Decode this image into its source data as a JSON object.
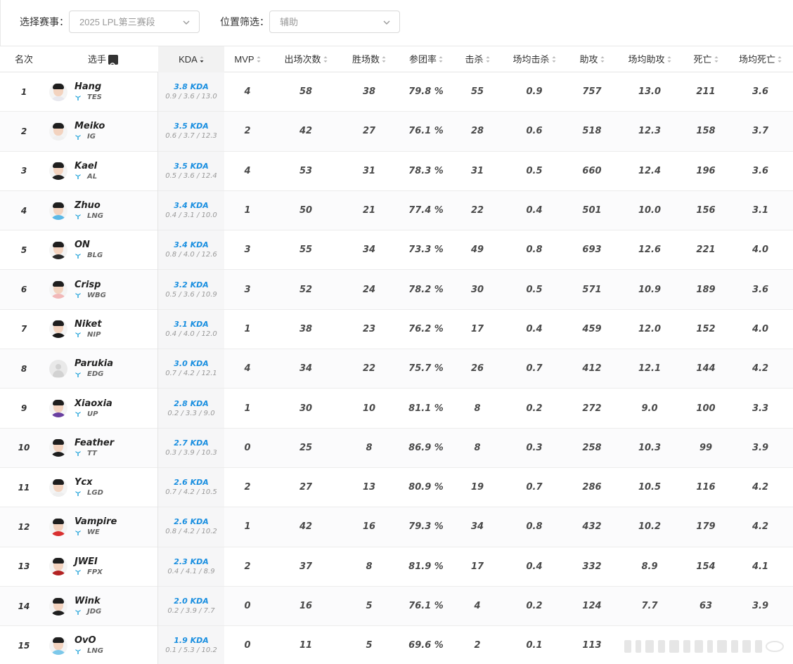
{
  "filters": {
    "event_label": "选择赛事：",
    "event_value": "2025 LPL第三赛段",
    "position_label": "位置筛选：",
    "position_value": "辅助"
  },
  "columns": {
    "rank": "名次",
    "player": "选手",
    "kda": "KDA",
    "mvp": "MVP",
    "games": "出场次数",
    "wins": "胜场数",
    "kp": "参团率",
    "kills": "击杀",
    "avg_kills": "场均击杀",
    "assists": "助攻",
    "avg_assists": "场均助攻",
    "deaths": "死亡",
    "avg_deaths": "场均死亡"
  },
  "rows": [
    {
      "rank": "1",
      "name": "Hang",
      "team": "TES",
      "kda": "3.8 KDA",
      "kda_detail": "0.9 / 3.6 / 13.0",
      "mvp": "4",
      "games": "58",
      "wins": "38",
      "kp": "79.8 %",
      "kills": "55",
      "avg_kills": "0.9",
      "assists": "757",
      "avg_assists": "13.0",
      "deaths": "211",
      "avg_deaths": "3.6",
      "avatar": "player",
      "shirt": "#e8e8ee"
    },
    {
      "rank": "2",
      "name": "Meiko",
      "team": "IG",
      "kda": "3.5 KDA",
      "kda_detail": "0.6 / 3.7 / 12.3",
      "mvp": "2",
      "games": "42",
      "wins": "27",
      "kp": "76.1 %",
      "kills": "28",
      "avg_kills": "0.6",
      "assists": "518",
      "avg_assists": "12.3",
      "deaths": "158",
      "avg_deaths": "3.7",
      "avatar": "player",
      "shirt": "#f0f0f0"
    },
    {
      "rank": "3",
      "name": "Kael",
      "team": "AL",
      "kda": "3.5 KDA",
      "kda_detail": "0.5 / 3.6 / 12.4",
      "mvp": "4",
      "games": "53",
      "wins": "31",
      "kp": "78.3 %",
      "kills": "31",
      "avg_kills": "0.5",
      "assists": "660",
      "avg_assists": "12.4",
      "deaths": "196",
      "avg_deaths": "3.6",
      "avatar": "player",
      "shirt": "#222222"
    },
    {
      "rank": "4",
      "name": "Zhuo",
      "team": "LNG",
      "kda": "3.4 KDA",
      "kda_detail": "0.4 / 3.1 / 10.0",
      "mvp": "1",
      "games": "50",
      "wins": "21",
      "kp": "77.4 %",
      "kills": "22",
      "avg_kills": "0.4",
      "assists": "501",
      "avg_assists": "10.0",
      "deaths": "156",
      "avg_deaths": "3.1",
      "avatar": "player",
      "shirt": "#5bb8e6"
    },
    {
      "rank": "5",
      "name": "ON",
      "team": "BLG",
      "kda": "3.4 KDA",
      "kda_detail": "0.8 / 4.0 / 12.6",
      "mvp": "3",
      "games": "55",
      "wins": "34",
      "kp": "73.3 %",
      "kills": "49",
      "avg_kills": "0.8",
      "assists": "693",
      "avg_assists": "12.6",
      "deaths": "221",
      "avg_deaths": "4.0",
      "avatar": "player",
      "shirt": "#2a2a2a"
    },
    {
      "rank": "6",
      "name": "Crisp",
      "team": "WBG",
      "kda": "3.2 KDA",
      "kda_detail": "0.5 / 3.6 / 10.9",
      "mvp": "3",
      "games": "52",
      "wins": "24",
      "kp": "78.2 %",
      "kills": "30",
      "avg_kills": "0.5",
      "assists": "571",
      "avg_assists": "10.9",
      "deaths": "189",
      "avg_deaths": "3.6",
      "avatar": "player",
      "shirt": "#f2b8b8"
    },
    {
      "rank": "7",
      "name": "Niket",
      "team": "NIP",
      "kda": "3.1 KDA",
      "kda_detail": "0.4 / 4.0 / 12.0",
      "mvp": "1",
      "games": "38",
      "wins": "23",
      "kp": "76.2 %",
      "kills": "17",
      "avg_kills": "0.4",
      "assists": "459",
      "avg_assists": "12.0",
      "deaths": "152",
      "avg_deaths": "4.0",
      "avatar": "player",
      "shirt": "#1a1a1a"
    },
    {
      "rank": "8",
      "name": "Parukia",
      "team": "EDG",
      "kda": "3.0 KDA",
      "kda_detail": "0.7 / 4.2 / 12.1",
      "mvp": "4",
      "games": "34",
      "wins": "22",
      "kp": "75.7 %",
      "kills": "26",
      "avg_kills": "0.7",
      "assists": "412",
      "avg_assists": "12.1",
      "deaths": "144",
      "avg_deaths": "4.2",
      "avatar": "blank",
      "shirt": "#d2d2d2"
    },
    {
      "rank": "9",
      "name": "Xiaoxia",
      "team": "UP",
      "kda": "2.8 KDA",
      "kda_detail": "0.2 / 3.3 / 9.0",
      "mvp": "1",
      "games": "30",
      "wins": "10",
      "kp": "81.1 %",
      "kills": "8",
      "avg_kills": "0.2",
      "assists": "272",
      "avg_assists": "9.0",
      "deaths": "100",
      "avg_deaths": "3.3",
      "avatar": "player",
      "shirt": "#6a3fa0"
    },
    {
      "rank": "10",
      "name": "Feather",
      "team": "TT",
      "kda": "2.7 KDA",
      "kda_detail": "0.3 / 3.9 / 10.3",
      "mvp": "0",
      "games": "25",
      "wins": "8",
      "kp": "86.9 %",
      "kills": "8",
      "avg_kills": "0.3",
      "assists": "258",
      "avg_assists": "10.3",
      "deaths": "99",
      "avg_deaths": "3.9",
      "avatar": "player",
      "shirt": "#1d1d1d"
    },
    {
      "rank": "11",
      "name": "Ycx",
      "team": "LGD",
      "kda": "2.6 KDA",
      "kda_detail": "0.7 / 4.2 / 10.5",
      "mvp": "2",
      "games": "27",
      "wins": "13",
      "kp": "80.9 %",
      "kills": "19",
      "avg_kills": "0.7",
      "assists": "286",
      "avg_assists": "10.5",
      "deaths": "116",
      "avg_deaths": "4.2",
      "avatar": "player",
      "shirt": "#eeeeee"
    },
    {
      "rank": "12",
      "name": "Vampire",
      "team": "WE",
      "kda": "2.6 KDA",
      "kda_detail": "0.8 / 4.2 / 10.2",
      "mvp": "1",
      "games": "42",
      "wins": "16",
      "kp": "79.3 %",
      "kills": "34",
      "avg_kills": "0.8",
      "assists": "432",
      "avg_assists": "10.2",
      "deaths": "179",
      "avg_deaths": "4.2",
      "avatar": "player",
      "shirt": "#d93030"
    },
    {
      "rank": "13",
      "name": "JWEI",
      "team": "FPX",
      "kda": "2.3 KDA",
      "kda_detail": "0.4 / 4.1 / 8.9",
      "mvp": "2",
      "games": "37",
      "wins": "8",
      "kp": "81.9 %",
      "kills": "17",
      "avg_kills": "0.4",
      "assists": "332",
      "avg_assists": "8.9",
      "deaths": "154",
      "avg_deaths": "4.1",
      "avatar": "player",
      "shirt": "#b32222"
    },
    {
      "rank": "14",
      "name": "Wink",
      "team": "JDG",
      "kda": "2.0 KDA",
      "kda_detail": "0.2 / 3.9 / 7.7",
      "mvp": "0",
      "games": "16",
      "wins": "5",
      "kp": "76.1 %",
      "kills": "4",
      "avg_kills": "0.2",
      "assists": "124",
      "avg_assists": "7.7",
      "deaths": "63",
      "avg_deaths": "3.9",
      "avatar": "player",
      "shirt": "#1e1e1e"
    },
    {
      "rank": "15",
      "name": "OvO",
      "team": "LNG",
      "kda": "1.9 KDA",
      "kda_detail": "0.1 / 5.3 / 10.2",
      "mvp": "0",
      "games": "11",
      "wins": "5",
      "kp": "69.6 %",
      "kills": "2",
      "avg_kills": "0.1",
      "assists": "113",
      "avg_assists": "",
      "deaths": "",
      "avg_deaths": "",
      "avatar": "player",
      "shirt": "#7cc8ea"
    }
  ],
  "colors": {
    "accent": "#1a8fe0",
    "team_logo": "#1aa0d8"
  }
}
